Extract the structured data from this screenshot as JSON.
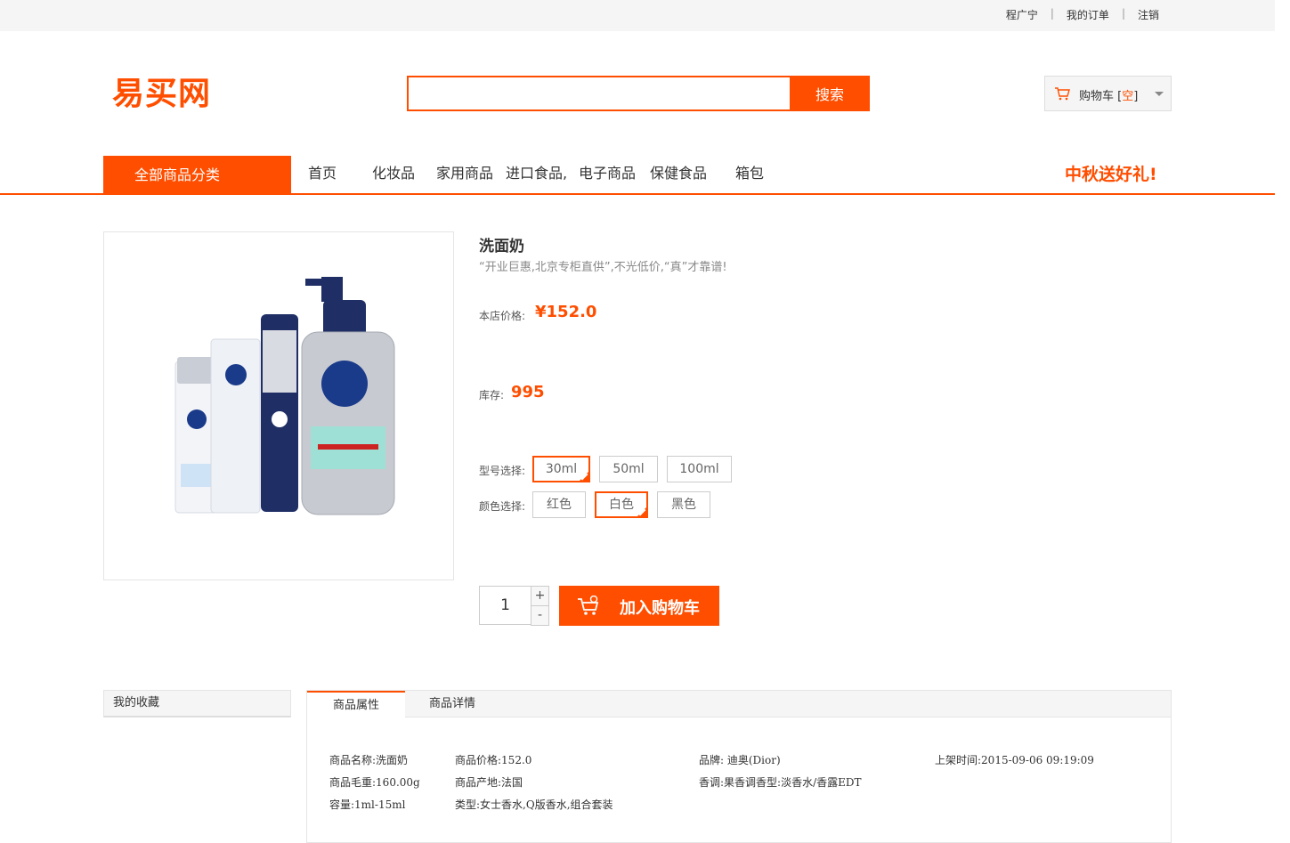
{
  "topbar": {
    "user": "程广宁",
    "orders": "我的订单",
    "logout": "注销",
    "sep": "|"
  },
  "logo": "易买网",
  "search": {
    "value": "",
    "button": "搜索"
  },
  "cart": {
    "label": "购物车 [",
    "count": "空",
    "close": "]"
  },
  "nav": {
    "all_categories": "全部商品分类",
    "items": [
      "首页",
      "化妆品",
      "家用商品",
      "进口食品,",
      "电子商品",
      "保健食品",
      "箱包"
    ],
    "promo": "中秋送好礼!"
  },
  "product": {
    "name": "洗面奶",
    "subtitle": "“开业巨惠,北京专柜直供”,不光低价,“真”才靠谱!",
    "price_label": "本店价格:",
    "price": "¥152.0",
    "stock_label": "库存:",
    "stock": "995",
    "model_label": "型号选择:",
    "models": [
      "30ml",
      "50ml",
      "100ml"
    ],
    "color_label": "颜色选择:",
    "colors": [
      "红色",
      "白色",
      "黑色"
    ],
    "quantity": "1",
    "plus": "+",
    "minus": "-",
    "add_to_cart": "加入购物车"
  },
  "sidebar": {
    "favorites": "我的收藏"
  },
  "tabs": {
    "attributes": "商品属性",
    "details": "商品详情"
  },
  "attributes": {
    "name": "商品名称:洗面奶",
    "price": "商品价格:152.0",
    "brand": "品牌: 迪奥(Dior)",
    "listed": "上架时间:2015-09-06 09:19:09",
    "weight": "商品毛重:160.00g",
    "origin": "商品产地:法国",
    "scent": "香调:果香调香型:淡香水/香露EDT",
    "capacity": "容量:1ml-15ml",
    "type": "类型:女士香水,Q版香水,组合套装"
  },
  "colors": {
    "accent": "#ff4e00",
    "bar_bg": "#f5f5f5"
  }
}
